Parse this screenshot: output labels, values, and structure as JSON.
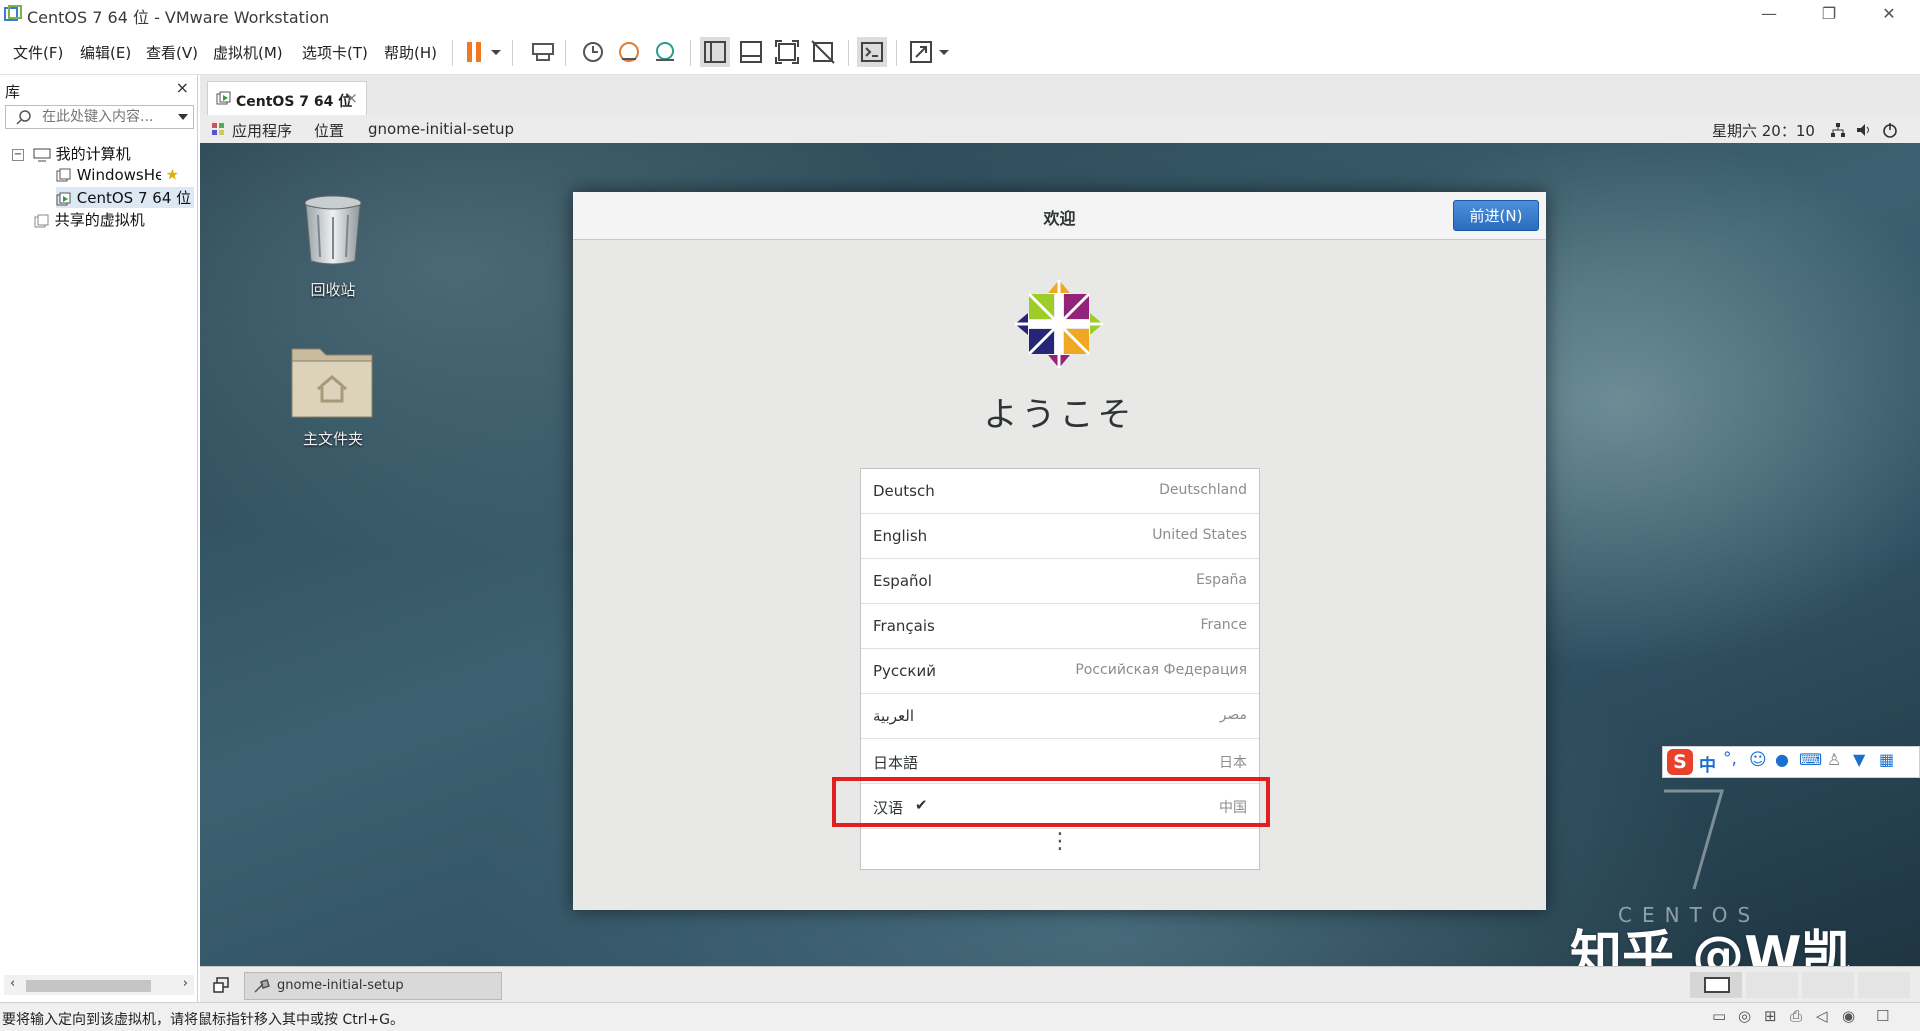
{
  "window": {
    "title": "CentOS 7 64 位 - VMware Workstation",
    "minimize": "—",
    "restore": "❐",
    "close": "✕"
  },
  "menu": [
    {
      "label": "文件(F)"
    },
    {
      "label": "编辑(E)"
    },
    {
      "label": "查看(V)"
    },
    {
      "label": "虚拟机(M)"
    },
    {
      "label": "选项卡(T)"
    },
    {
      "label": "帮助(H)"
    }
  ],
  "toolbar_icons": [
    "pause-icon",
    "dropdown-icon",
    "send-keys-icon",
    "snapshot-icon",
    "revert-snapshot-icon",
    "snapshot-manager-icon",
    "sidebar-view-icon",
    "thumbnail-view-icon",
    "fullscreen-icon",
    "unity-icon",
    "console-icon",
    "stretch-icon"
  ],
  "library": {
    "title": "库",
    "close": "×",
    "search_placeholder": "在此处键入内容...",
    "tree": {
      "root": "我的计算机",
      "items": [
        "WindowsHe",
        "CentOS 7 64 位"
      ],
      "shared": "共享的虚拟机"
    }
  },
  "vm_tab": {
    "label": "CentOS 7 64 位",
    "close": "×"
  },
  "gnome_bar": {
    "applications": "应用程序",
    "places": "位置",
    "app_name": "gnome-initial-setup",
    "clock": "星期六 20：10"
  },
  "desktop": {
    "trash_label": "回收站",
    "home_label": "主文件夹",
    "centos_word": "CENTOS",
    "centos_number": "7",
    "watermark": "知乎 @W凯"
  },
  "ime": {
    "label": "中"
  },
  "dialog": {
    "title": "欢迎",
    "next_button": "前进(N)",
    "heading": "ようこそ",
    "languages": [
      {
        "name": "Deutsch",
        "region": "Deutschland",
        "selected": false
      },
      {
        "name": "English",
        "region": "United States",
        "selected": false
      },
      {
        "name": "Español",
        "region": "España",
        "selected": false
      },
      {
        "name": "Français",
        "region": "France",
        "selected": false
      },
      {
        "name": "Русский",
        "region": "Российская Федерация",
        "selected": false
      },
      {
        "name": "العربية",
        "region": "مصر",
        "selected": false
      },
      {
        "name": "日本語",
        "region": "日本",
        "selected": false
      },
      {
        "name": "汉语",
        "region": "中国",
        "selected": true
      }
    ],
    "check_mark": "✔",
    "more": "⋮"
  },
  "taskbar": {
    "item": "gnome-initial-setup"
  },
  "status": {
    "message": "要将输入定向到该虚拟机，请将鼠标指针移入其中或按 Ctrl+G。"
  },
  "colors": {
    "accent": "#2c6cc0",
    "highlight": "#e02020",
    "pause": "#f07820"
  }
}
